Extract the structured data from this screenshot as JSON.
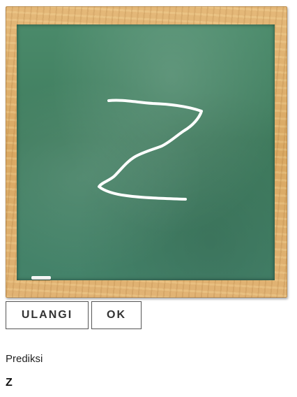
{
  "board": {
    "drawn_character": "Z"
  },
  "controls": {
    "reset_label": "ULANGI",
    "ok_label": "OK"
  },
  "prediction": {
    "label": "Prediksi",
    "value": "Z"
  },
  "colors": {
    "chalkboard": "#3f7c5e",
    "frame": "#d9a862",
    "chalk": "#ffffff"
  }
}
